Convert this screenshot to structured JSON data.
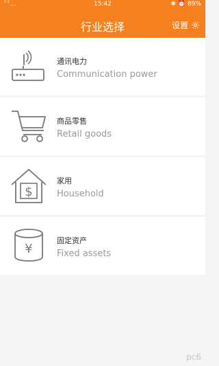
{
  "status_bar": {
    "signal": "ᵀᵀ…",
    "time": "15:42",
    "indicators": "✱ ⏰ 89%"
  },
  "header": {
    "title": "行业选择",
    "settings_label": "设置"
  },
  "industries": [
    {
      "zh": "通讯电力",
      "en": "Communication power",
      "icon": "router-icon"
    },
    {
      "zh": "商品零售",
      "en": "Retail goods",
      "icon": "shopping-cart-icon"
    },
    {
      "zh": "家用",
      "en": "Household",
      "icon": "house-dollar-icon"
    },
    {
      "zh": "固定资产",
      "en": "Fixed assets",
      "icon": "yen-cylinder-icon"
    }
  ],
  "watermark": "pc6"
}
